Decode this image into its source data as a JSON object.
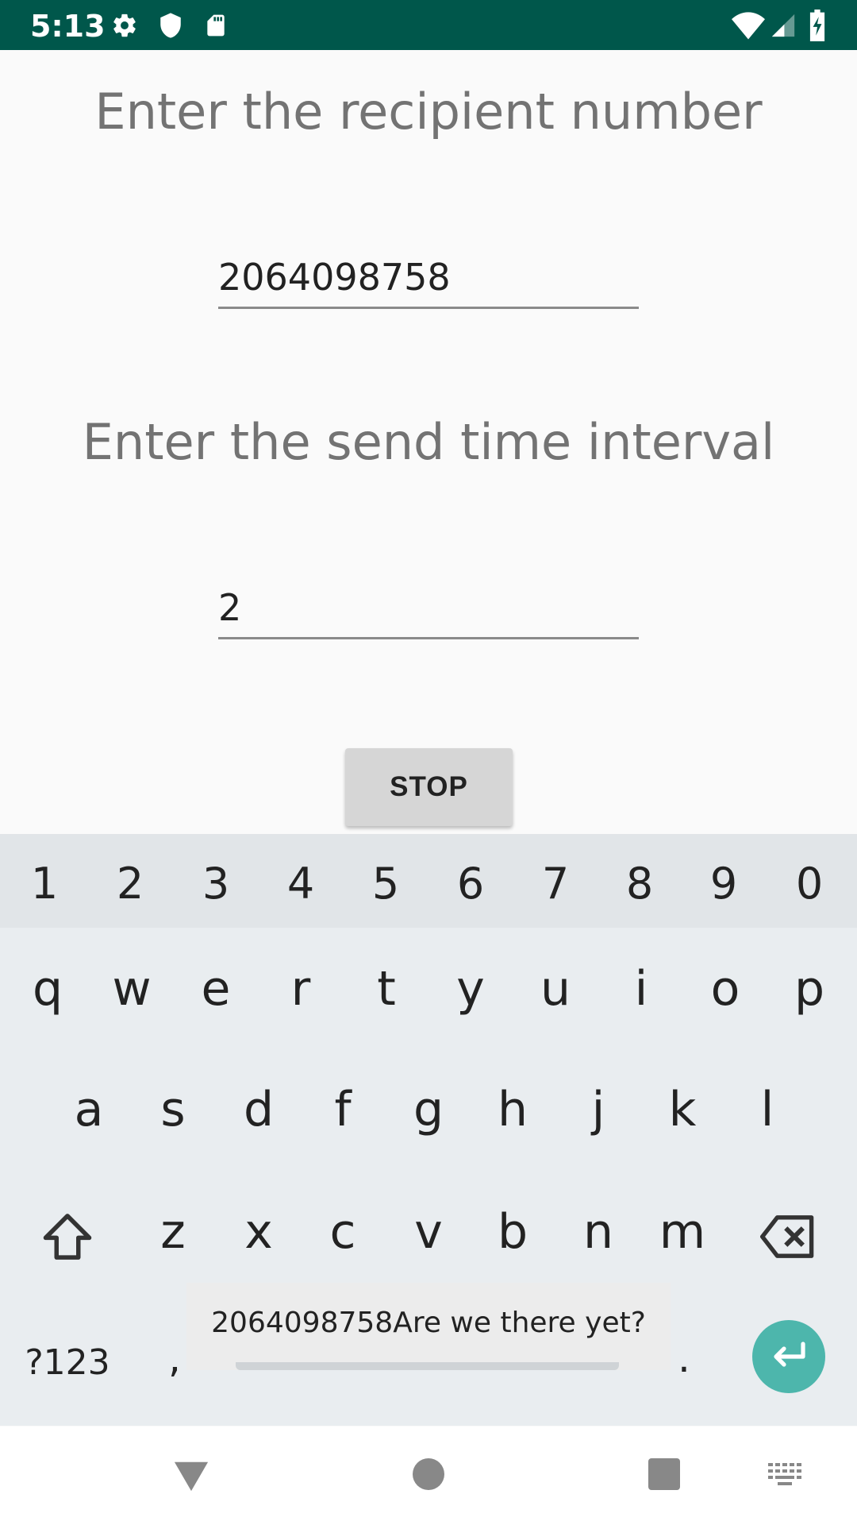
{
  "status_bar": {
    "time": "5:13",
    "icons": [
      "settings-icon",
      "shield-icon",
      "sd-card-icon",
      "wifi-icon",
      "signal-icon",
      "battery-icon"
    ],
    "background": "#00574b"
  },
  "form": {
    "recipient_prompt": "Enter the recipient number",
    "recipient_value": "2064098758",
    "interval_prompt": "Enter the send time interval",
    "interval_value": "2",
    "stop_label": "STOP"
  },
  "keyboard": {
    "number_row": [
      "1",
      "2",
      "3",
      "4",
      "5",
      "6",
      "7",
      "8",
      "9",
      "0"
    ],
    "row1": [
      "q",
      "w",
      "e",
      "r",
      "t",
      "y",
      "u",
      "i",
      "o",
      "p"
    ],
    "row2": [
      "a",
      "s",
      "d",
      "f",
      "g",
      "h",
      "j",
      "k",
      "l"
    ],
    "row3": [
      "z",
      "x",
      "c",
      "v",
      "b",
      "n",
      "m"
    ],
    "symbols_label": "?123",
    "comma_label": ",",
    "period_label": ".",
    "suggestion": "2064098758Are we there yet?",
    "icons": [
      "shift-icon",
      "backspace-icon",
      "enter-icon"
    ],
    "accent": "#4db6ac"
  },
  "nav_bar": {
    "icons": [
      "back-icon",
      "home-icon",
      "recents-icon",
      "keyboard-switch-icon"
    ]
  }
}
